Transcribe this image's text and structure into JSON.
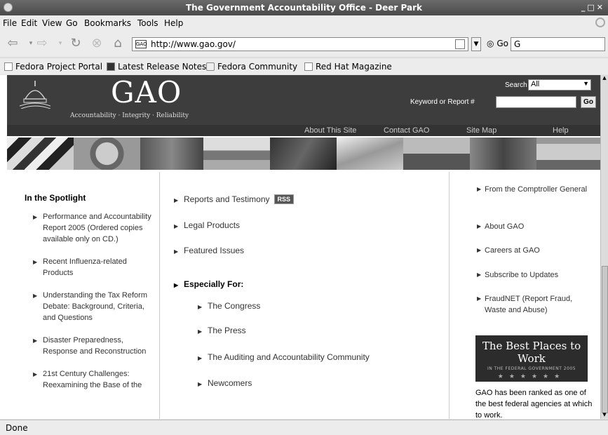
{
  "window": {
    "title": "The Government Accountability Office - Deer Park"
  },
  "menu": [
    "File",
    "Edit",
    "View",
    "Go",
    "Bookmarks",
    "Tools",
    "Help"
  ],
  "toolbar": {
    "url": "http://www.gao.gov/",
    "favicon_text": "GAO",
    "go_label": "Go",
    "search_value": "G"
  },
  "bookmarks": [
    "Fedora Project Portal",
    "Latest Release Notes",
    "Fedora Community",
    "Red Hat Magazine"
  ],
  "header": {
    "logo": "GAO",
    "tagline": "Accountability · Integrity · Reliability",
    "search_label": "Search",
    "search_select": "All",
    "keyword_label": "Keyword or Report #",
    "go_button": "Go"
  },
  "topnav": [
    "About This Site",
    "Contact GAO",
    "Site Map",
    "Help"
  ],
  "spotlight": {
    "title": "In the Spotlight",
    "items": [
      "Performance and Accountability Report 2005 (Ordered copies available only on CD.)",
      "Recent Influenza-related Products",
      "Understanding the Tax Reform Debate: Background, Criteria, and Questions",
      "Disaster Preparedness, Response and Reconstruction",
      "21st Century Challenges: Reexamining the Base of the"
    ]
  },
  "main": {
    "reports": "Reports and Testimony",
    "rss": "RSS",
    "legal": "Legal Products",
    "featured": "Featured Issues",
    "especially": "Especially For:",
    "sub": [
      "The Congress",
      "The Press",
      "The Auditing and Accountability Community",
      "Newcomers"
    ]
  },
  "right": {
    "items": [
      "From the Comptroller General",
      "About GAO",
      "Careers at GAO",
      "Subscribe to Updates",
      "FraudNET (Report Fraud, Waste and Abuse)"
    ],
    "bestplaces_title": "The Best Places to Work",
    "bestplaces_sub": "IN THE FEDERAL GOVERNMENT 2005",
    "bestplaces_stars": "★★★★★★",
    "ranked": "GAO has been ranked as one of the best federal agencies at which to work."
  },
  "status": "Done"
}
